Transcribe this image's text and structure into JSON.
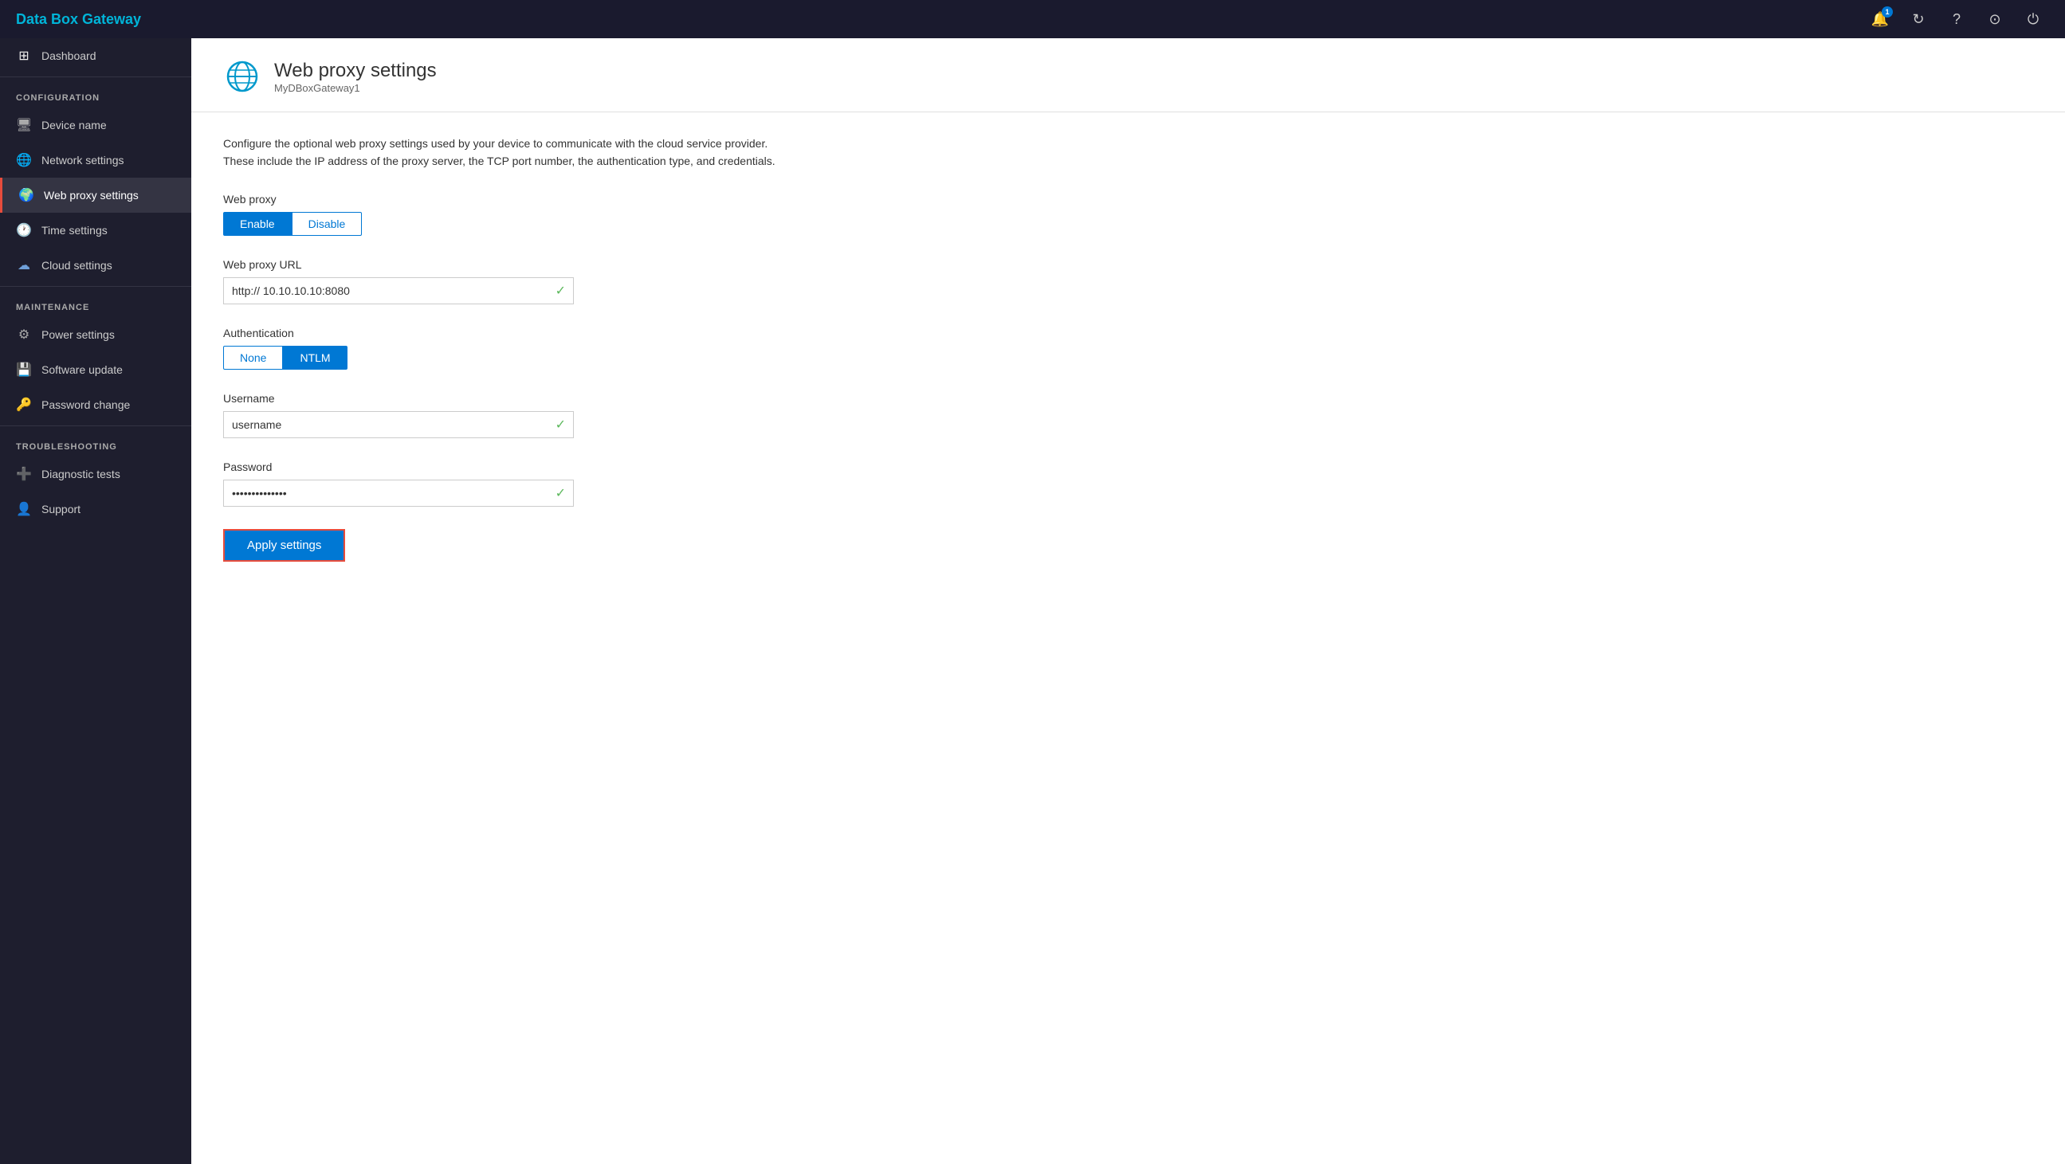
{
  "app": {
    "brand": "Data Box Gateway"
  },
  "topbar": {
    "notification_count": "1",
    "icons": [
      "bell-icon",
      "refresh-icon",
      "help-icon",
      "circle-icon",
      "power-icon"
    ]
  },
  "sidebar": {
    "dashboard_label": "Dashboard",
    "config_section": "CONFIGURATION",
    "nav_items_config": [
      {
        "id": "device-name",
        "label": "Device name",
        "icon": "🖥"
      },
      {
        "id": "network-settings",
        "label": "Network settings",
        "icon": "🌐"
      },
      {
        "id": "web-proxy-settings",
        "label": "Web proxy settings",
        "icon": "🌍",
        "active": true
      },
      {
        "id": "time-settings",
        "label": "Time settings",
        "icon": "🕐"
      },
      {
        "id": "cloud-settings",
        "label": "Cloud settings",
        "icon": "☁"
      }
    ],
    "maintenance_section": "MAINTENANCE",
    "nav_items_maintenance": [
      {
        "id": "power-settings",
        "label": "Power settings",
        "icon": "⚙"
      },
      {
        "id": "software-update",
        "label": "Software update",
        "icon": "💾"
      },
      {
        "id": "password-change",
        "label": "Password change",
        "icon": "🔑"
      }
    ],
    "troubleshooting_section": "TROUBLESHOOTING",
    "nav_items_troubleshooting": [
      {
        "id": "diagnostic-tests",
        "label": "Diagnostic tests",
        "icon": "➕"
      },
      {
        "id": "support",
        "label": "Support",
        "icon": "👤"
      }
    ]
  },
  "page": {
    "title": "Web proxy settings",
    "subtitle": "MyDBoxGateway1",
    "description_line1": "Configure the optional web proxy settings used by your device to communicate with the cloud service provider.",
    "description_line2": "These include the IP address of the proxy server, the TCP port  number, the authentication type, and credentials.",
    "web_proxy_label": "Web proxy",
    "enable_label": "Enable",
    "disable_label": "Disable",
    "url_label": "Web proxy URL",
    "url_value": "http:// 10.10.10.10:8080",
    "auth_label": "Authentication",
    "none_label": "None",
    "ntlm_label": "NTLM",
    "username_label": "Username",
    "username_value": "username",
    "password_label": "Password",
    "password_value": "••••••••••••••",
    "apply_label": "Apply settings"
  }
}
